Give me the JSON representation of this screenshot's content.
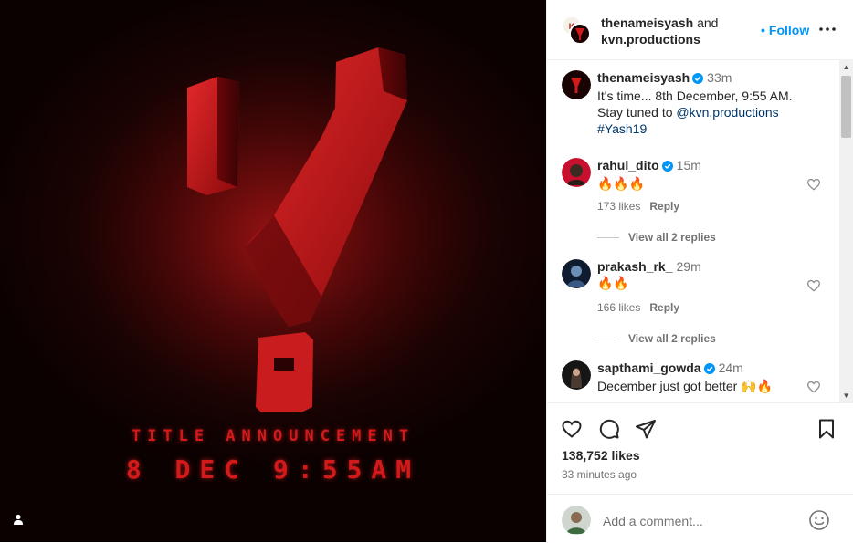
{
  "media": {
    "title_text": "TITLE ANNOUNCEMENT",
    "date_text": "8 DEC 9:55AM",
    "tag_icon": "user-tag-icon"
  },
  "header": {
    "owner_one": "thenameisyash",
    "joiner": "and",
    "owner_two": "kvn.productions",
    "follow_dot": "•",
    "follow_label": "Follow",
    "more_icon": "more-options-icon"
  },
  "caption": {
    "username": "thenameisyash",
    "verified": true,
    "time": "33m",
    "line1": "It's time... 8th December, 9:55 AM.",
    "line2_prefix": "Stay tuned to ",
    "mention": "@kvn.productions",
    "hashtag": "#Yash19"
  },
  "comments": [
    {
      "username": "rahul_dito",
      "verified": true,
      "time": "15m",
      "text": "🔥🔥🔥",
      "likes": "173 likes",
      "reply_label": "Reply",
      "view_replies": "View all 2 replies"
    },
    {
      "username": "prakash_rk_",
      "verified": false,
      "time": "29m",
      "text": "🔥🔥",
      "likes": "166 likes",
      "reply_label": "Reply",
      "view_replies": "View all 2 replies"
    },
    {
      "username": "sapthami_gowda",
      "verified": true,
      "time": "24m",
      "text": "December just got better 🙌🔥"
    }
  ],
  "actions": {
    "like_icon": "heart-icon",
    "comment_icon": "comment-icon",
    "share_icon": "share-icon",
    "save_icon": "bookmark-icon",
    "likes_count": "138,752 likes",
    "posted_ago": "33 minutes ago"
  },
  "composer": {
    "placeholder": "Add a comment...",
    "value": "",
    "emoji_icon": "emoji-icon"
  },
  "colors": {
    "accent": "#0095f6",
    "poster_red": "#d21a1a",
    "verified_blue": "#0095f6",
    "secondary_text": "#737373"
  }
}
